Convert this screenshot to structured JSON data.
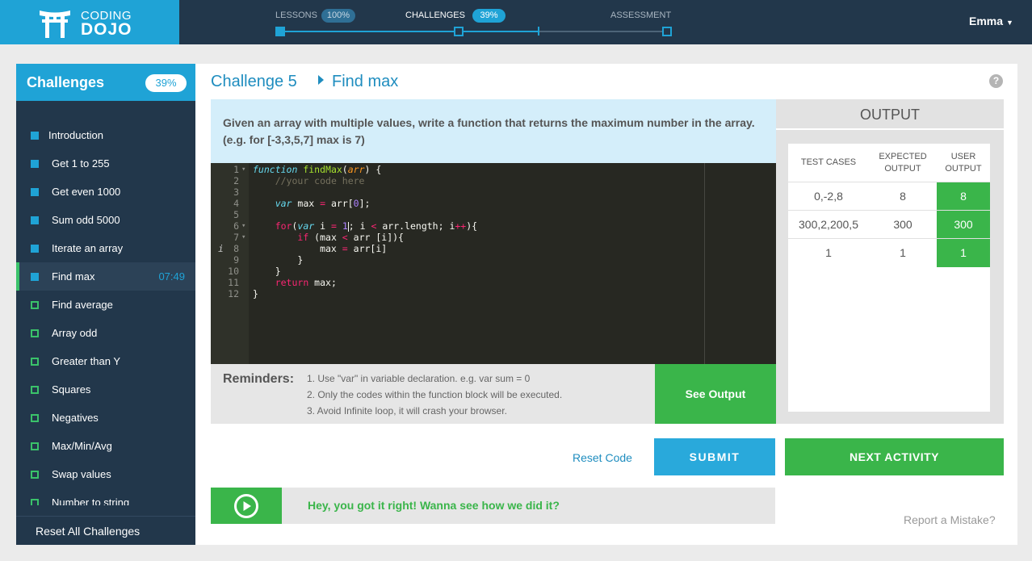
{
  "logo": {
    "line1": "CODING",
    "line2": "DOJO"
  },
  "progress": {
    "lessons": {
      "label": "LESSONS",
      "percent": "100%"
    },
    "challenges": {
      "label": "CHALLENGES",
      "percent": "39%"
    },
    "assessment": {
      "label": "ASSESSMENT"
    },
    "overall_fraction": 0.39
  },
  "user": {
    "name": "Emma"
  },
  "sidebar": {
    "title": "Challenges",
    "percent": "39%",
    "items": [
      {
        "label": "Introduction",
        "status": "done"
      },
      {
        "label": "Get 1 to 255",
        "status": "done"
      },
      {
        "label": "Get even 1000",
        "status": "done"
      },
      {
        "label": "Sum odd 5000",
        "status": "done"
      },
      {
        "label": "Iterate an array",
        "status": "done"
      },
      {
        "label": "Find max",
        "status": "current",
        "time": "07:49"
      },
      {
        "label": "Find average",
        "status": "todo"
      },
      {
        "label": "Array odd",
        "status": "todo"
      },
      {
        "label": "Greater than Y",
        "status": "todo"
      },
      {
        "label": "Squares",
        "status": "todo"
      },
      {
        "label": "Negatives",
        "status": "todo"
      },
      {
        "label": "Max/Min/Avg",
        "status": "todo"
      },
      {
        "label": "Swap values",
        "status": "todo"
      },
      {
        "label": "Number to string",
        "status": "todo"
      }
    ],
    "reset_label": "Reset All Challenges"
  },
  "challenge": {
    "number_label": "Challenge 5",
    "name": "Find max",
    "help": "?",
    "prompt": "Given an array with multiple values, write a function that returns the maximum number in the array. (e.g. for [-3,3,5,7] max is 7)"
  },
  "editor": {
    "line_numbers": [
      "1",
      "2",
      "3",
      "4",
      "5",
      "6",
      "7",
      "8",
      "9",
      "10",
      "11",
      "12"
    ],
    "fold_marker": "▾",
    "annotation": "i",
    "lines": [
      "function findMax(arr) {",
      "    //your code here",
      "",
      "    var max = arr[0];",
      "",
      "    for(var i = 1; i < arr.length; i++){",
      "        if (max < arr [i]){",
      "            max = arr[i]",
      "        }",
      "    }",
      "    return max;",
      "}"
    ]
  },
  "reminders": {
    "label": "Reminders:",
    "items": [
      "1. Use \"var\" in variable declaration. e.g. var sum = 0",
      "2. Only the codes within the function block will be executed.",
      "3. Avoid Infinite loop, it will crash your browser."
    ],
    "button": "See Output"
  },
  "output": {
    "title": "OUTPUT",
    "headers": {
      "test": "TEST CASES",
      "expected": "EXPECTED OUTPUT",
      "user": "USER OUTPUT"
    },
    "rows": [
      {
        "test": "0,-2,8",
        "expected": "8",
        "user": "8"
      },
      {
        "test": "300,2,200,5",
        "expected": "300",
        "user": "300"
      },
      {
        "test": "1",
        "expected": "1",
        "user": "1"
      }
    ]
  },
  "actions": {
    "reset": "Reset Code",
    "submit": "SUBMIT",
    "next": "NEXT ACTIVITY"
  },
  "banner": {
    "text": "Hey, you got it right! Wanna see how we did it?"
  },
  "report": "Report a Mistake?",
  "colors": {
    "brand_blue": "#1fa3d6",
    "nav_dark": "#22374b",
    "success_green": "#3ab54a",
    "editor_bg": "#272822"
  }
}
